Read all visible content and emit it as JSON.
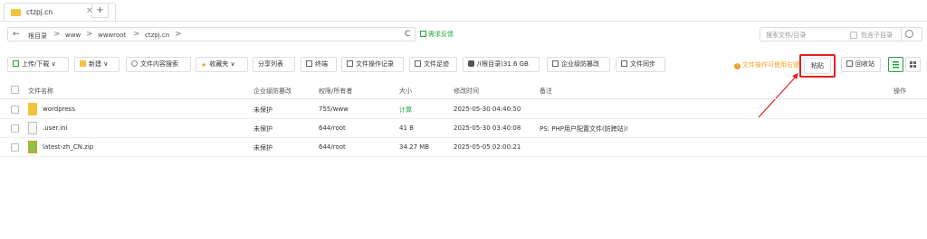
{
  "tab": {
    "title": "ctzpj.cn",
    "close": "×",
    "add": "+"
  },
  "path": {
    "back": "←",
    "items": [
      "根目录",
      "www",
      "wwwroot",
      "ctzpj.cn"
    ],
    "sep": ">",
    "refresh": "C"
  },
  "feedback": "需求反馈",
  "search": {
    "placeholder": "搜索文件/目录",
    "include_sub": "包含子目录"
  },
  "toolbar": {
    "upload": "上传/下载",
    "new": "新建",
    "content_search": "文件内容搜索",
    "favorites": "收藏夹",
    "share_list": "分享列表",
    "terminal": "终端",
    "op_log": "文件操作记录",
    "footprint": "文件足迹",
    "disk": "/(根目录)31.6 GB",
    "defense": "企业级防篡改",
    "sync": "文件同步",
    "warning": "文件操作可使用右键",
    "paste": "粘贴",
    "recycle": "回收站"
  },
  "table": {
    "headers": {
      "name": "文件名称",
      "defense": "企业级防篡改",
      "perm": "权限/所有者",
      "size": "大小",
      "mtime": "修改时间",
      "note": "备注",
      "ops": "操作"
    },
    "rows": [
      {
        "name": "wordpress",
        "defense": "未保护",
        "perm": "755/www",
        "size": "计算",
        "mtime": "2025-05-30 04:40:50",
        "note": ""
      },
      {
        "name": ".user.ini",
        "defense": "未保护",
        "perm": "644/root",
        "size": "41 B",
        "mtime": "2025-05-30 03:40:08",
        "note": "PS: PHP用户配置文件(防跨站)!"
      },
      {
        "name": "latest-zh_CN.zip",
        "defense": "未保护",
        "perm": "644/root",
        "size": "34.27 MB",
        "mtime": "2025-05-05 02:00:21",
        "note": ""
      }
    ]
  },
  "colors": {
    "accent": "#20a53a",
    "warning": "#f0a020",
    "highlight": "#e02020"
  }
}
